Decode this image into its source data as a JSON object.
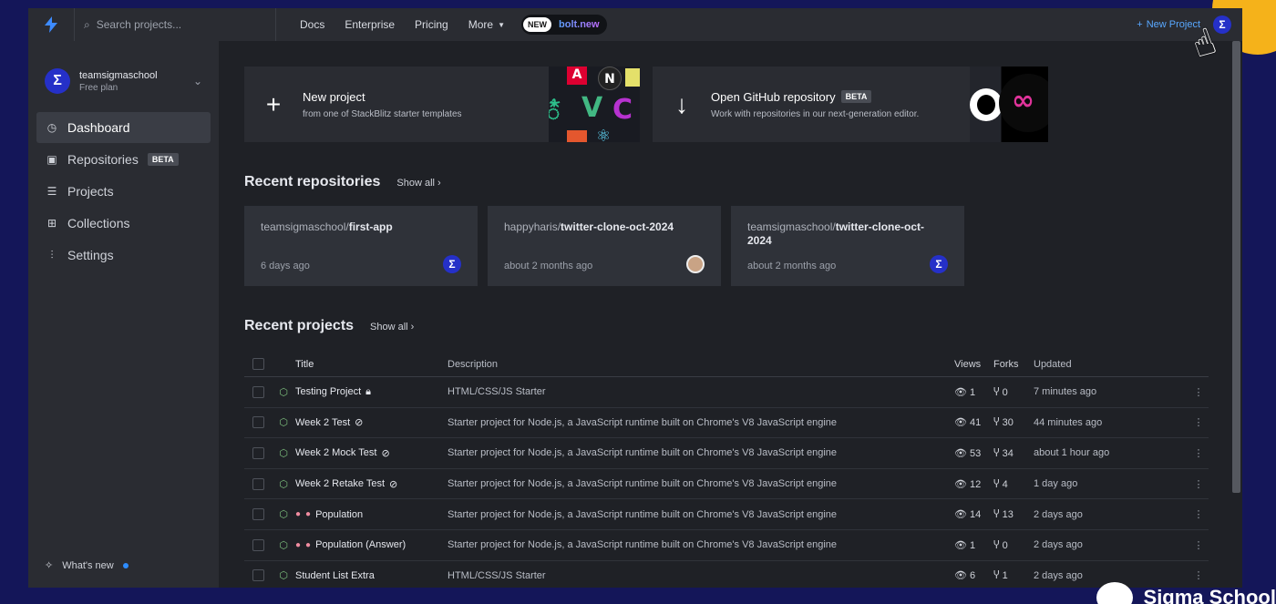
{
  "topbar": {
    "search_placeholder": "Search projects...",
    "nav": [
      "Docs",
      "Enterprise",
      "Pricing",
      "More"
    ],
    "bolt_badge": "NEW",
    "bolt_name": "bolt.new",
    "new_project": "New Project"
  },
  "sidebar": {
    "team_name": "teamsigmaschool",
    "plan": "Free plan",
    "items": [
      {
        "label": "Dashboard",
        "icon": "clock-icon"
      },
      {
        "label": "Repositories",
        "icon": "repo-icon",
        "badge": "BETA"
      },
      {
        "label": "Projects",
        "icon": "list-icon"
      },
      {
        "label": "Collections",
        "icon": "grid-icon"
      },
      {
        "label": "Settings",
        "icon": "sliders-icon"
      }
    ],
    "whats_new": "What's new"
  },
  "cards": {
    "new_title": "New project",
    "new_sub": "from one of StackBlitz starter templates",
    "gh_title": "Open GitHub repository",
    "gh_badge": "BETA",
    "gh_sub": "Work with repositories in our next-generation editor."
  },
  "recent_repos": {
    "heading": "Recent repositories",
    "show_all": "Show all",
    "items": [
      {
        "owner": "teamsigmaschool/",
        "name": "first-app",
        "time": "6 days ago"
      },
      {
        "owner": "happyharis/",
        "name": "twitter-clone-oct-2024",
        "time": "about 2 months ago"
      },
      {
        "owner": "teamsigmaschool/",
        "name": "twitter-clone-oct-2024",
        "time": "about 2 months ago"
      }
    ]
  },
  "recent_projects": {
    "heading": "Recent projects",
    "show_all": "Show all",
    "columns": [
      "Title",
      "Description",
      "Views",
      "Forks",
      "Updated"
    ],
    "rows": [
      {
        "title": "Testing Project",
        "desc": "HTML/CSS/JS Starter",
        "views": "1",
        "forks": "0",
        "updated": "7 minutes ago"
      },
      {
        "title": "Week 2 Test",
        "desc": "Starter project for Node.js, a JavaScript runtime built on Chrome's V8 JavaScript engine",
        "views": "41",
        "forks": "30",
        "updated": "44 minutes ago"
      },
      {
        "title": "Week 2 Mock Test",
        "desc": "Starter project for Node.js, a JavaScript runtime built on Chrome's V8 JavaScript engine",
        "views": "53",
        "forks": "34",
        "updated": "about 1 hour ago"
      },
      {
        "title": "Week 2 Retake Test",
        "desc": "Starter project for Node.js, a JavaScript runtime built on Chrome's V8 JavaScript engine",
        "views": "12",
        "forks": "4",
        "updated": "1 day ago"
      },
      {
        "title": "Population",
        "desc": "Starter project for Node.js, a JavaScript runtime built on Chrome's V8 JavaScript engine",
        "views": "14",
        "forks": "13",
        "updated": "2 days ago"
      },
      {
        "title": "Population (Answer)",
        "desc": "Starter project for Node.js, a JavaScript runtime built on Chrome's V8 JavaScript engine",
        "views": "1",
        "forks": "0",
        "updated": "2 days ago"
      },
      {
        "title": "Student List Extra",
        "desc": "HTML/CSS/JS Starter",
        "views": "6",
        "forks": "1",
        "updated": "2 days ago"
      }
    ]
  },
  "watermark": "Sigma School"
}
